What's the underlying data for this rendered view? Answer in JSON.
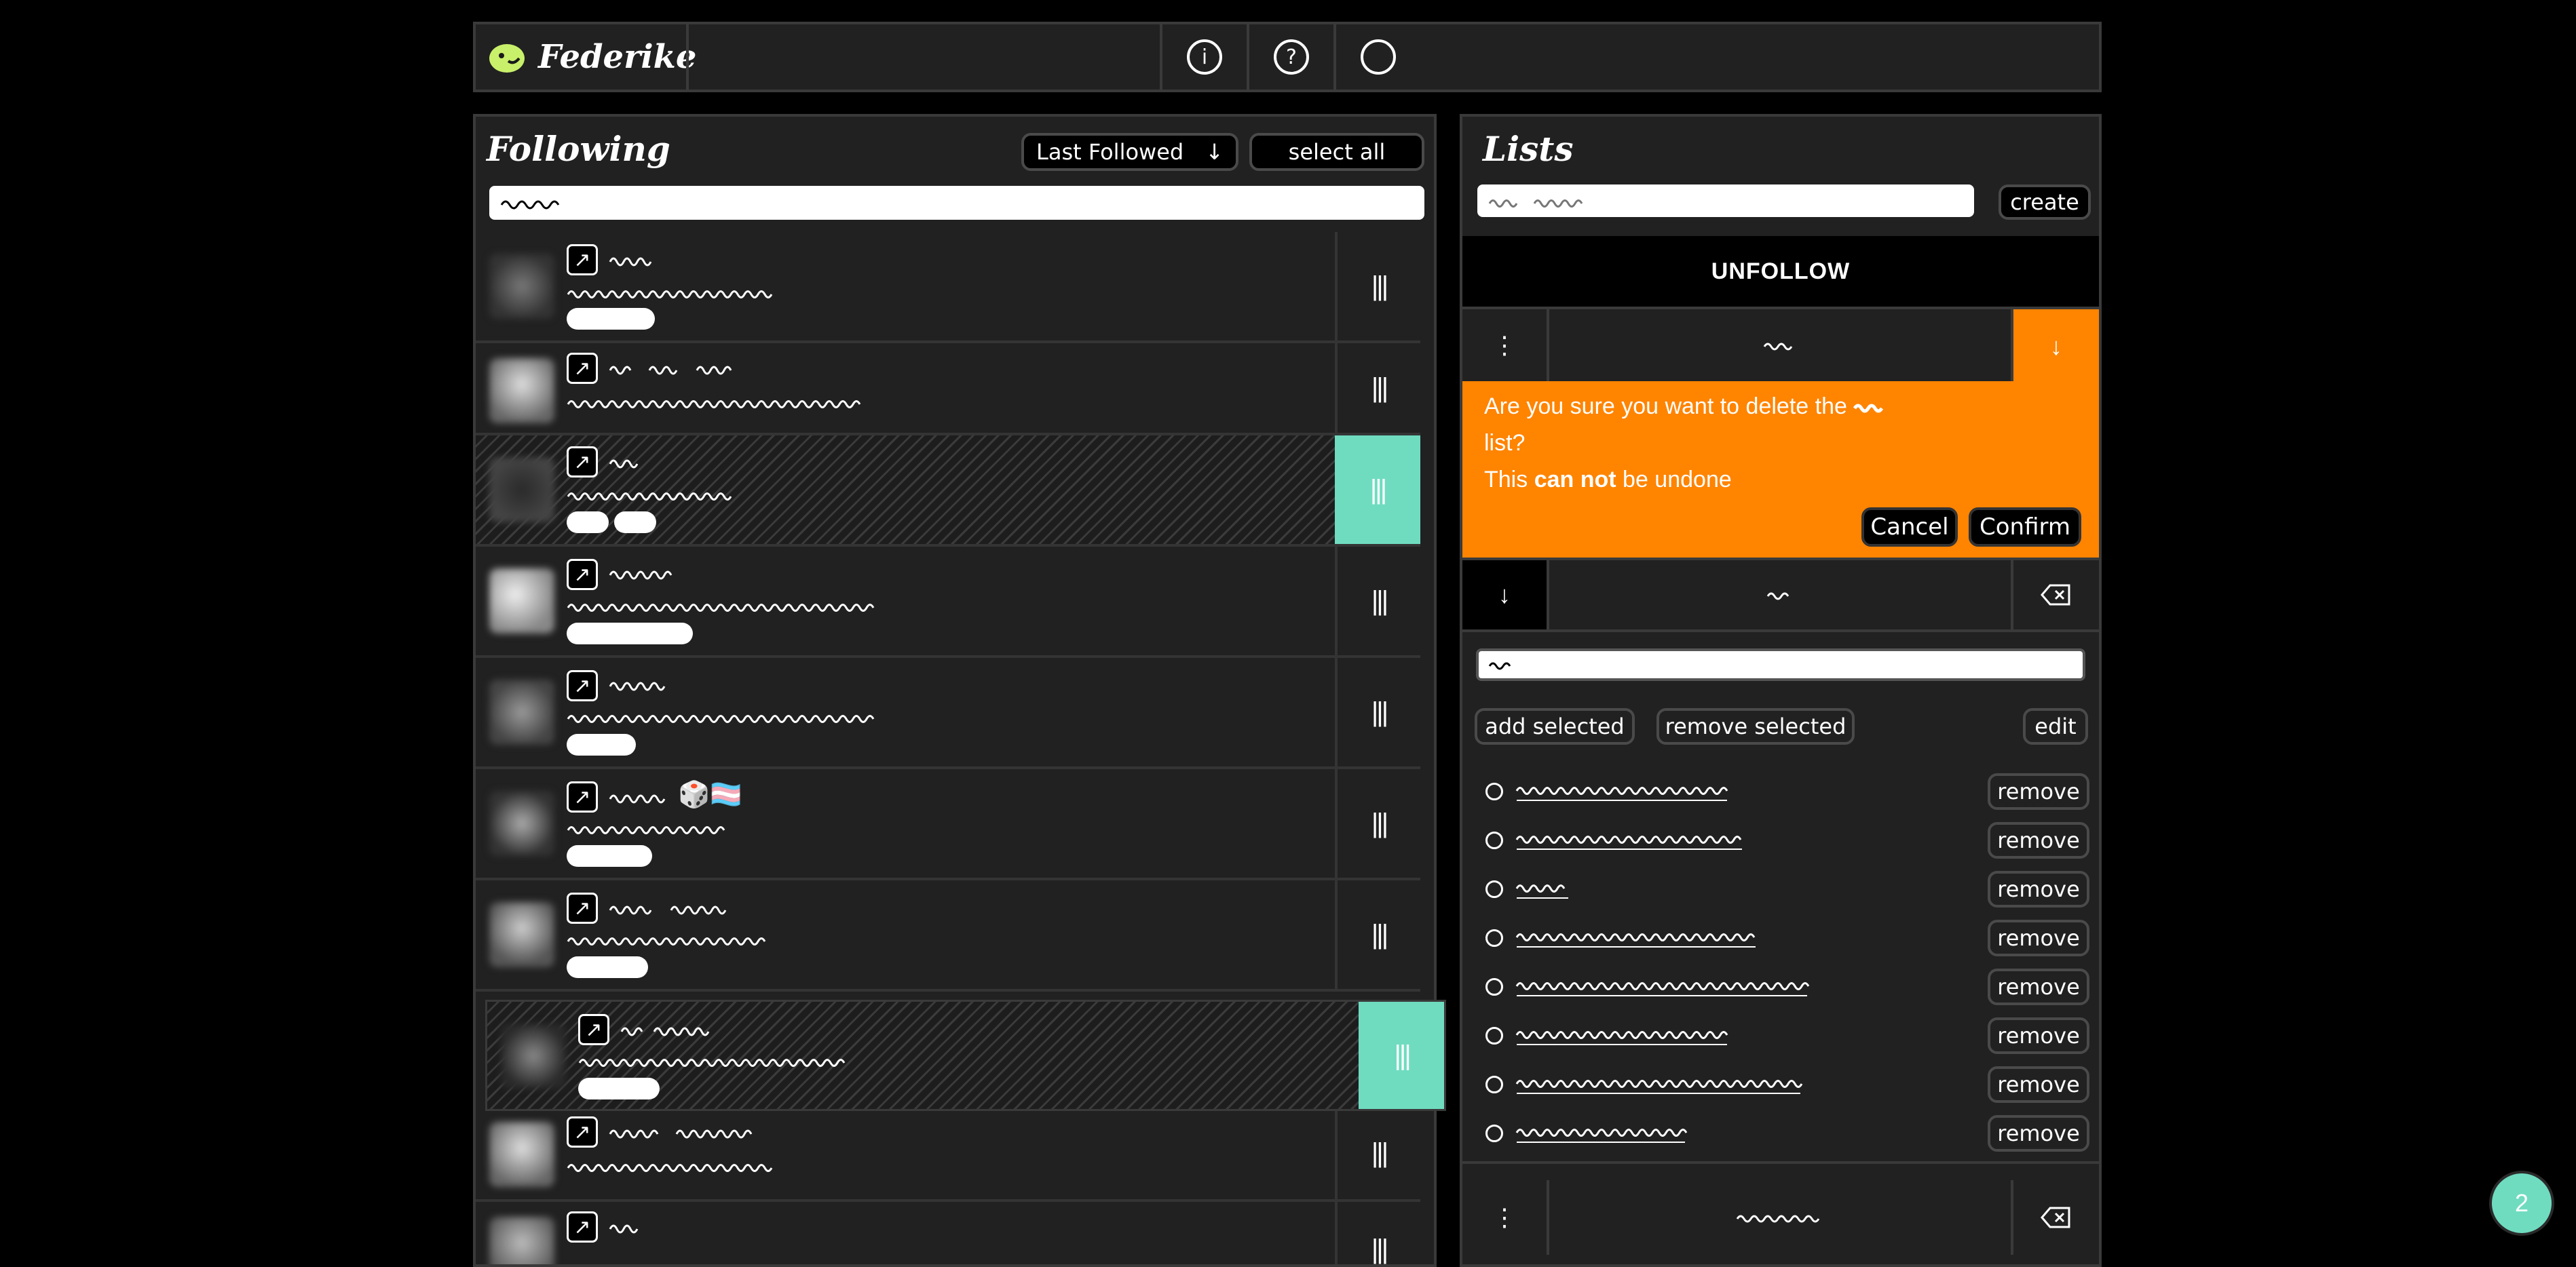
{
  "header": {
    "app_name": "Federike",
    "info_icon_label": "i",
    "help_icon_label": "?"
  },
  "following": {
    "title": "Following",
    "sort_label": "Last Followed",
    "select_all_label": "select all"
  },
  "rows": [
    {
      "flag": "",
      "selected": false
    },
    {
      "flag": "",
      "selected": false
    },
    {
      "flag": "",
      "selected": true
    },
    {
      "flag": "",
      "selected": false
    },
    {
      "flag": "",
      "selected": false
    },
    {
      "flag": "🎲🏳️‍⚧️",
      "selected": false
    },
    {
      "flag": "",
      "selected": false
    },
    {
      "flag": "",
      "selected": true
    },
    {
      "flag": "",
      "selected": false
    },
    {
      "flag": "",
      "selected": false
    }
  ],
  "lists": {
    "title": "Lists",
    "create_label": "create",
    "unfollow_label": "UNFOLLOW",
    "confirm": {
      "line1": "Are you sure you want to delete the",
      "line2": "list?",
      "line3_a": "This",
      "line3_b": "can not",
      "line3_c": "be undone",
      "cancel_label": "Cancel",
      "confirm_label": "Confirm"
    },
    "add_selected_label": "add selected",
    "remove_selected_label": "remove selected",
    "edit_label": "edit",
    "remove_label": "remove"
  },
  "fab": {
    "count": "2"
  },
  "colors": {
    "accent_teal": "#6fdcc0",
    "warning_orange": "#ff8400",
    "logo_green": "#c8f06a"
  }
}
